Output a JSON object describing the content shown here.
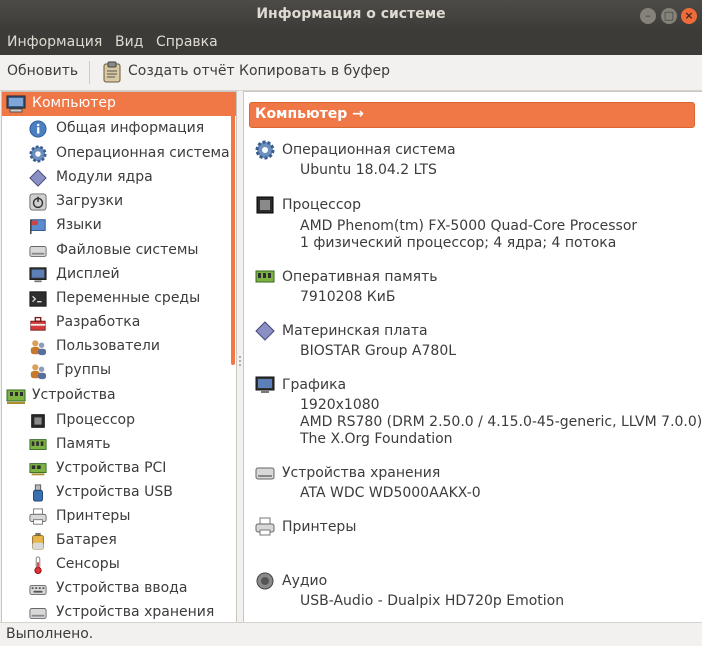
{
  "window": {
    "title": "Информация о системе"
  },
  "menu": [
    "Информация",
    "Вид",
    "Справка"
  ],
  "toolbar": {
    "refresh": "Обновить",
    "report": "Создать отчёт",
    "copy": "Копировать в буфер"
  },
  "tree": {
    "computer": "Компьютер",
    "computer_items": [
      "Общая информация",
      "Операционная система",
      "Модули ядра",
      "Загрузки",
      "Языки",
      "Файловые системы",
      "Дисплей",
      "Переменные среды",
      "Разработка",
      "Пользователи",
      "Группы"
    ],
    "devices": "Устройства",
    "device_items": [
      "Процессор",
      "Память",
      "Устройства PCI",
      "Устройства USB",
      "Принтеры",
      "Батарея",
      "Сенсоры",
      "Устройства ввода",
      "Устройства хранения"
    ]
  },
  "detail": {
    "header": "Компьютер →",
    "sections": [
      {
        "title": "Операционная система",
        "values": [
          "Ubuntu 18.04.2 LTS"
        ]
      },
      {
        "title": "Процессор",
        "values": [
          "AMD Phenom(tm) FX-5000 Quad-Core Processor",
          "1 физический процессор; 4 ядра; 4 потока"
        ]
      },
      {
        "title": "Оперативная память",
        "values": [
          "7910208 КиБ"
        ]
      },
      {
        "title": "Материнская плата",
        "values": [
          "BIOSTAR Group A780L"
        ]
      },
      {
        "title": "Графика",
        "values": [
          "1920x1080",
          "AMD RS780 (DRM 2.50.0 / 4.15.0-45-generic, LLVM 7.0.0)",
          "The X.Org Foundation"
        ]
      },
      {
        "title": "Устройства хранения",
        "values": [
          "ATA WDC WD5000AAKX-0"
        ]
      },
      {
        "title": "Принтеры",
        "values": []
      },
      {
        "title": "Аудио",
        "values": [
          "USB-Audio - Dualpix HD720p Emotion"
        ]
      }
    ]
  },
  "status": "Выполнено.",
  "colors": {
    "accent": "#f07746",
    "titlebar": "#3c3b37"
  }
}
